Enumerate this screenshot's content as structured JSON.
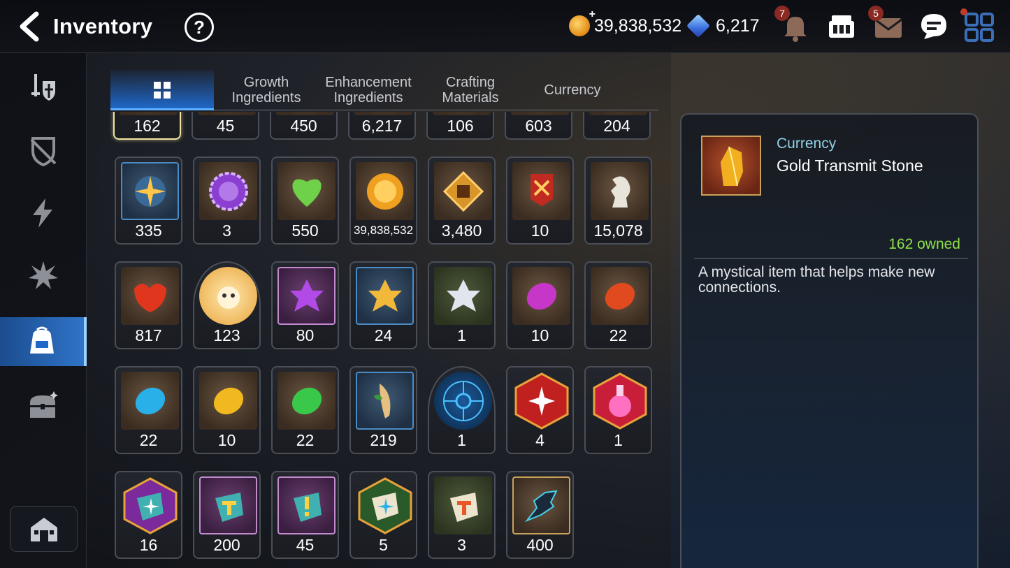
{
  "header": {
    "title": "Inventory",
    "help_label": "?",
    "gold": "39,838,532",
    "crystals": "6,217",
    "notifications_badge": "7",
    "mail_badge": "5"
  },
  "icons": {
    "back": "back-arrow-icon",
    "help": "help-icon",
    "gold": "gold-coin-icon",
    "crystal": "crystal-icon",
    "bell": "bell-icon",
    "shop": "shop-icon",
    "mail": "mail-icon",
    "chat": "chat-icon",
    "menu": "grid-menu-icon"
  },
  "sidebar": {
    "items": [
      {
        "name": "equipment",
        "icon": "sword-shield-icon"
      },
      {
        "name": "artifacts",
        "icon": "broken-shield-icon"
      },
      {
        "name": "catalysts",
        "icon": "lightning-icon"
      },
      {
        "name": "runes",
        "icon": "burst-icon"
      },
      {
        "name": "items",
        "icon": "backpack-icon",
        "active": true
      },
      {
        "name": "storage",
        "icon": "chest-icon"
      }
    ],
    "bottom": "house-icon"
  },
  "tabs": [
    {
      "label": "",
      "icon": "grid-icon",
      "active": true
    },
    {
      "label": "Growth\nIngredients"
    },
    {
      "label": "Enhancement\nIngredients"
    },
    {
      "label": "Crafting\nMaterials"
    },
    {
      "label": "Currency"
    }
  ],
  "grid": {
    "row0": [
      "162",
      "45",
      "450",
      "6,217",
      "106",
      "603",
      "204"
    ],
    "row1": [
      "335",
      "3",
      "550",
      "39,838,532",
      "3,480",
      "10",
      "15,078"
    ],
    "row2": [
      "817",
      "123",
      "80",
      "24",
      "1",
      "10",
      "22"
    ],
    "row3": [
      "22",
      "10",
      "22",
      "219",
      "1",
      "4",
      "1"
    ],
    "row4": [
      "16",
      "200",
      "45",
      "5",
      "3",
      "400"
    ]
  },
  "detail": {
    "category": "Currency",
    "name": "Gold Transmit Stone",
    "owned": "162 owned",
    "description": "A mystical item that helps make new connections."
  },
  "colors": {
    "accent": "#2f74c8",
    "owned_green": "#8fe04a",
    "category_cyan": "#8fd0e6",
    "selected_border": "#efe2a0"
  }
}
